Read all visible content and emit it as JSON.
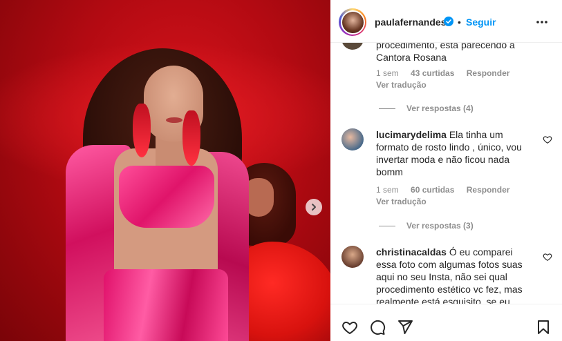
{
  "post": {
    "username": "paulafernandes",
    "follow_label": "Seguir",
    "separator": "•"
  },
  "comments": [
    {
      "text_continued": "procedimento, está parecendo a Cantora Rosana",
      "time": "1 sem",
      "likes": "43 curtidas",
      "reply": "Responder",
      "translate": "Ver tradução",
      "view_replies": "Ver respostas (4)"
    },
    {
      "username": "lucimarydelima",
      "text": "Ela tinha um formato de rosto lindo , único, vou invertar moda e não ficou nada bomm",
      "time": "1 sem",
      "likes": "60 curtidas",
      "reply": "Responder",
      "translate": "Ver tradução",
      "view_replies": "Ver respostas (3)"
    },
    {
      "username": "christinacaldas",
      "text": "Ó eu comparei essa foto com algumas fotos suas aqui no seu Insta, não sei qual procedimento estético vc fez, mas realmente está esquisito, se eu fosse"
    }
  ],
  "icons": {
    "verified": "verified-badge-icon",
    "more": "more-options-icon",
    "next": "chevron-right-icon",
    "like": "heart-icon",
    "comment": "comment-icon",
    "share": "send-icon",
    "save": "bookmark-icon"
  },
  "colors": {
    "accent": "#0095f6",
    "text": "#262626",
    "muted": "#8e8e8e"
  }
}
